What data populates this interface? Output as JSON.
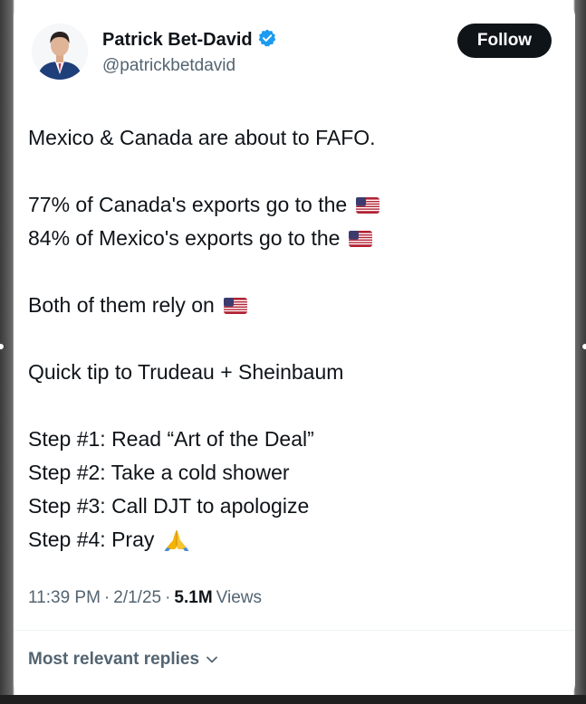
{
  "author": {
    "display_name": "Patrick Bet-David",
    "handle": "@patrickbetdavid",
    "verified": true,
    "verified_color": "#1d9bf0"
  },
  "follow_button": {
    "label": "Follow"
  },
  "tweet": {
    "lines": [
      {
        "text": "Mexico & Canada are about to FAFO.",
        "emoji": ""
      },
      {
        "text": "",
        "emoji": ""
      },
      {
        "text": "77% of Canada's exports go to the",
        "emoji": "us-flag"
      },
      {
        "text": "84% of Mexico's exports go to the",
        "emoji": "us-flag"
      },
      {
        "text": "",
        "emoji": ""
      },
      {
        "text": "Both of them rely on",
        "emoji": "us-flag"
      },
      {
        "text": "",
        "emoji": ""
      },
      {
        "text": "Quick tip to Trudeau + Sheinbaum",
        "emoji": ""
      },
      {
        "text": "",
        "emoji": ""
      },
      {
        "text": "Step #1: Read “Art of the Deal”",
        "emoji": ""
      },
      {
        "text": "Step #2: Take a cold shower",
        "emoji": ""
      },
      {
        "text": "Step #3: Call DJT to apologize",
        "emoji": ""
      },
      {
        "text": "Step #4: Pray",
        "emoji": "folded-hands"
      }
    ]
  },
  "meta": {
    "time": "11:39 PM",
    "separator": "·",
    "date": "2/1/25",
    "views_count": "5.1M",
    "views_label": "Views"
  },
  "replies": {
    "label": "Most relevant replies"
  },
  "icons": {
    "verified": "verified-badge-icon",
    "chevron": "chevron-down-icon",
    "flag": "us-flag-icon",
    "pray": "folded-hands-icon"
  }
}
